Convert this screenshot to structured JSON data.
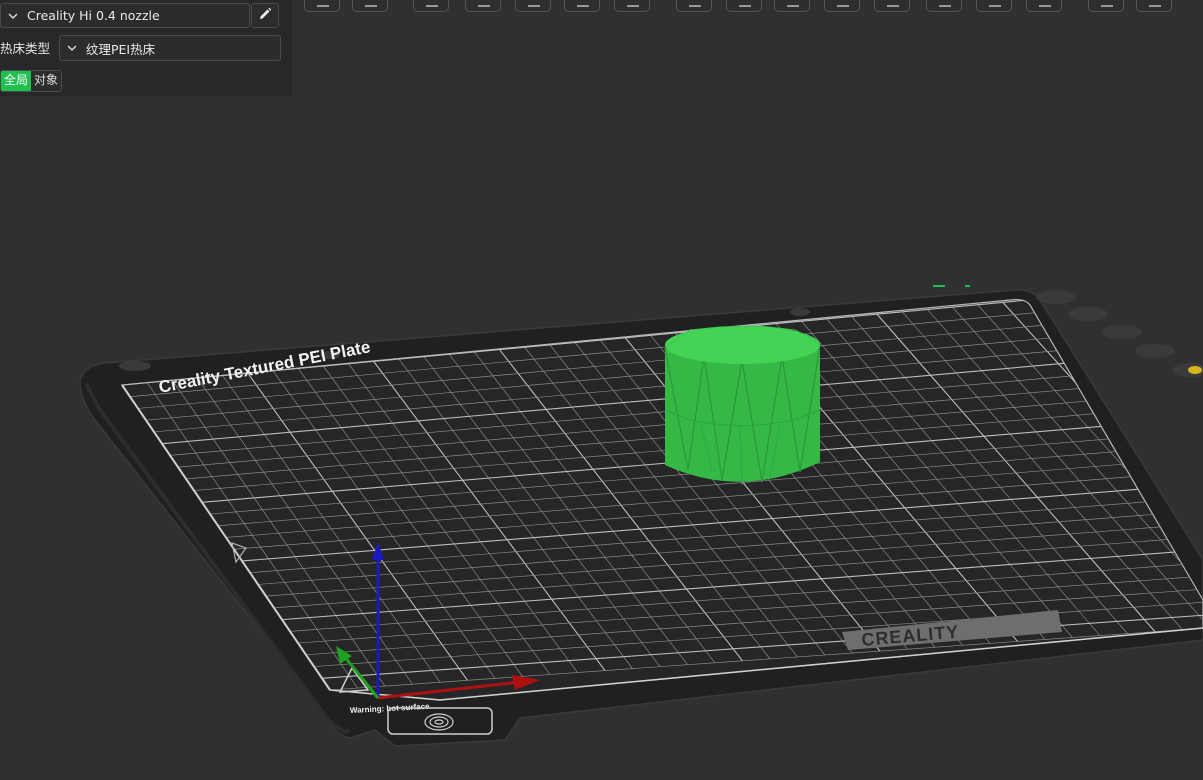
{
  "printer": {
    "name": "Creality Hi 0.4 nozzle"
  },
  "bed": {
    "label": "热床类型",
    "value": "纹理PEI热床"
  },
  "scope_toggle": {
    "global": "全局",
    "object": "对象"
  },
  "plate": {
    "title": "Creality Textured PEI Plate",
    "brand": "CREALITY",
    "warning": "Warning: hot surface"
  },
  "colors": {
    "accent": "#1ec04f",
    "model": "#3bc24a",
    "background": "#303031"
  },
  "icons": [
    "chevron-down-icon",
    "pencil-icon",
    "fingerprint-icon"
  ]
}
